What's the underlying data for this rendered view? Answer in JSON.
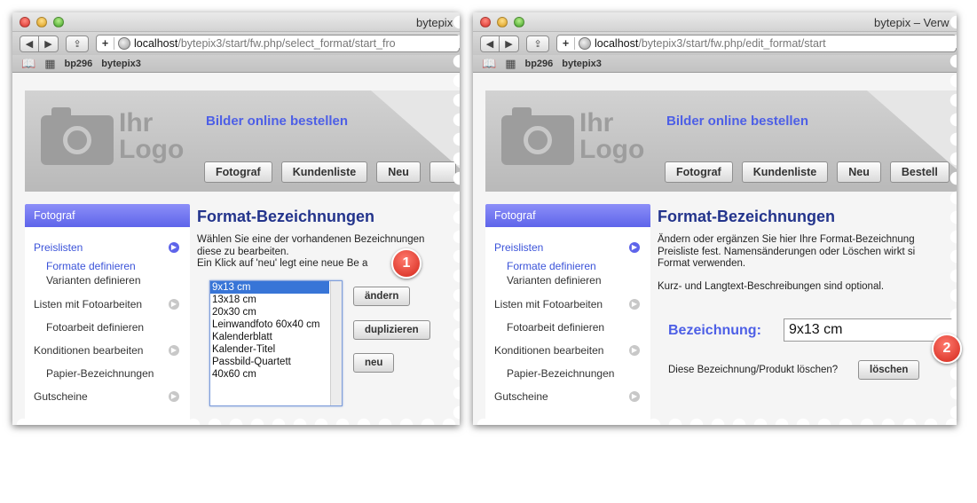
{
  "left": {
    "window_title": "bytepix",
    "url_host": "localhost",
    "url_path": "/bytepix3/start/fw.php/select_format/start_fro",
    "bookmarks": [
      "bp296",
      "bytepix3"
    ],
    "brand_title": "Bilder online bestellen",
    "logo_text": [
      "Ihr",
      "Logo"
    ],
    "nav": [
      "Fotograf",
      "Kundenliste",
      "Neu"
    ],
    "sidebar": {
      "header": "Fotograf",
      "items": [
        {
          "label": "Preislisten"
        },
        {
          "label": "Formate definieren"
        },
        {
          "label": "Varianten definieren"
        },
        {
          "label": "Listen mit Fotoarbeiten"
        },
        {
          "label": "Fotoarbeit definieren"
        },
        {
          "label": "Konditionen bearbeiten"
        },
        {
          "label": "Papier-Bezeichnungen"
        },
        {
          "label": "Gutscheine"
        }
      ]
    },
    "heading": "Format-Bezeichnungen",
    "text_lines": [
      "Wählen Sie eine der vorhandenen Bezeichnungen",
      "diese zu bearbeiten.",
      "Ein Klick auf 'neu' legt eine neue Be                  a"
    ],
    "formats": [
      "9x13 cm",
      "13x18 cm",
      "20x30 cm",
      "Leinwandfoto 60x40 cm",
      "Kalenderblatt",
      "Kalender-Titel",
      "Passbild-Quartett",
      "40x60 cm"
    ],
    "selected_format": "9x13 cm",
    "buttons": {
      "edit": "ändern",
      "duplicate": "duplizieren",
      "new": "neu"
    },
    "badge": "1"
  },
  "right": {
    "window_title": "bytepix – Verw",
    "url_host": "localhost",
    "url_path": "/bytepix3/start/fw.php/edit_format/start",
    "bookmarks": [
      "bp296",
      "bytepix3"
    ],
    "brand_title": "Bilder online bestellen",
    "logo_text": [
      "Ihr",
      "Logo"
    ],
    "nav": [
      "Fotograf",
      "Kundenliste",
      "Neu",
      "Bestell"
    ],
    "sidebar": {
      "header": "Fotograf",
      "items": [
        {
          "label": "Preislisten"
        },
        {
          "label": "Formate definieren"
        },
        {
          "label": "Varianten definieren"
        },
        {
          "label": "Listen mit Fotoarbeiten"
        },
        {
          "label": "Fotoarbeit definieren"
        },
        {
          "label": "Konditionen bearbeiten"
        },
        {
          "label": "Papier-Bezeichnungen"
        },
        {
          "label": "Gutscheine"
        }
      ]
    },
    "heading": "Format-Bezeichnungen",
    "text_lines": [
      "Ändern oder ergänzen Sie hier Ihre Format-Bezeichnung",
      "Preisliste fest. Namensänderungen oder Löschen wirkt si",
      "Format verwenden."
    ],
    "optional_note": "Kurz- und Langtext-Beschreibungen sind optional.",
    "field_label": "Bezeichnung:",
    "field_value": "9x13 cm",
    "delete_prompt": "Diese Bezeichnung/Produkt löschen?",
    "delete_button": "löschen",
    "badge": "2"
  },
  "colors": {
    "accent": "#4d5fe6",
    "heading": "#23348c",
    "badge": "#d3261a",
    "sidebar_head": "#5e64ea"
  }
}
